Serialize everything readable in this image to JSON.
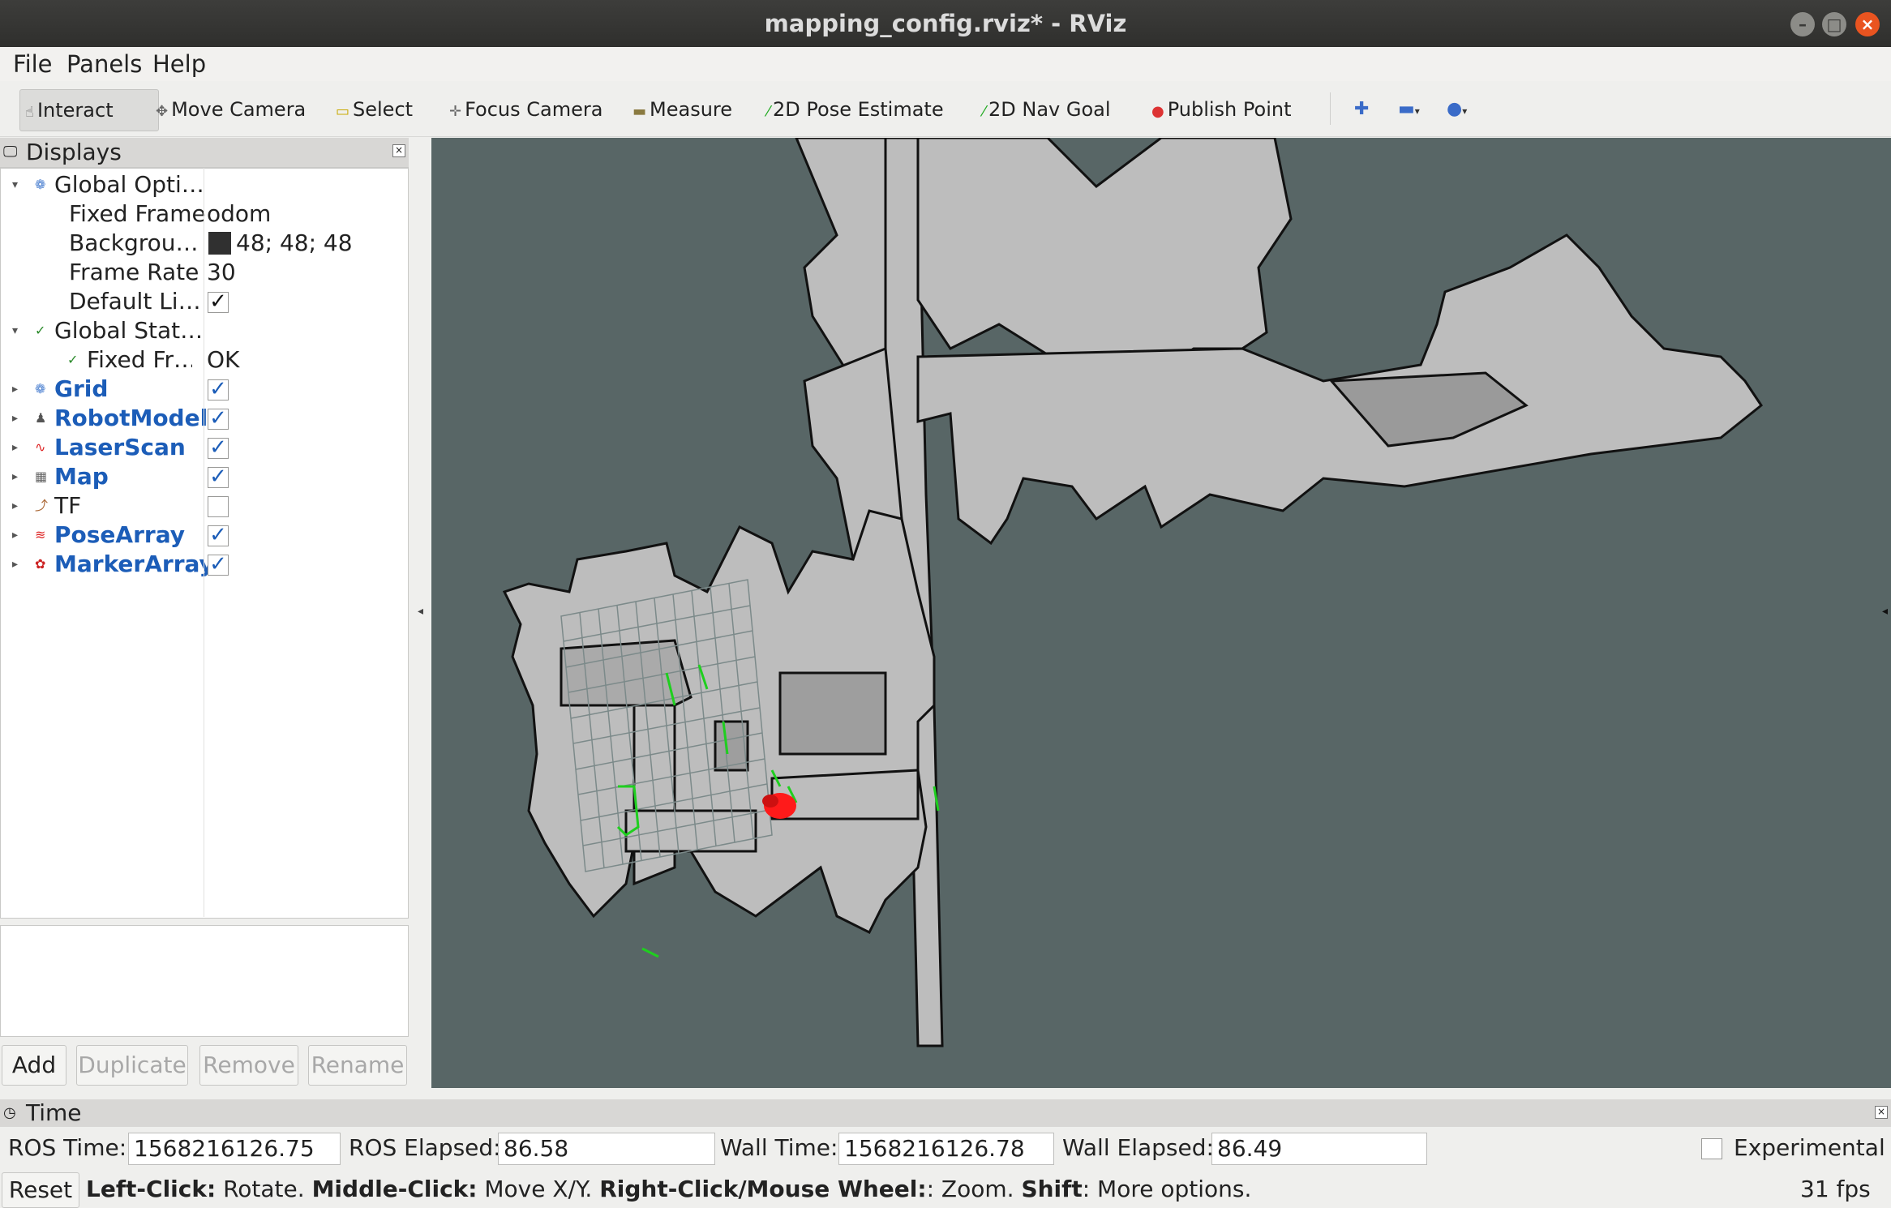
{
  "window": {
    "title": "mapping_config.rviz* - RViz"
  },
  "menu": {
    "file": "File",
    "panels": "Panels",
    "help": "Help"
  },
  "toolbar": {
    "interact": "Interact",
    "move_camera": "Move Camera",
    "select": "Select",
    "focus_camera": "Focus Camera",
    "measure": "Measure",
    "pose_estimate": "2D Pose Estimate",
    "nav_goal": "2D Nav Goal",
    "publish_point": "Publish Point"
  },
  "displays": {
    "title": "Displays",
    "global_options": {
      "label": "Global Opti…",
      "fixed_frame": {
        "label": "Fixed Frame",
        "value": "odom"
      },
      "background": {
        "label": "Backgrou…",
        "value": "48; 48; 48",
        "swatch": "#303030"
      },
      "frame_rate": {
        "label": "Frame Rate",
        "value": "30"
      },
      "default_light": {
        "label": "Default Li…",
        "checked": true
      }
    },
    "global_status": {
      "label": "Global Stat…",
      "fixed_frame": {
        "label": "Fixed Fr…",
        "value": "OK"
      }
    },
    "items": [
      {
        "label": "Grid",
        "checked": true,
        "icon": "grid-icon"
      },
      {
        "label": "RobotModel",
        "checked": true,
        "icon": "robot-icon"
      },
      {
        "label": "LaserScan",
        "checked": true,
        "icon": "laser-icon"
      },
      {
        "label": "Map",
        "checked": true,
        "icon": "map-icon"
      },
      {
        "label": "TF",
        "checked": false,
        "icon": "tf-icon"
      },
      {
        "label": "PoseArray",
        "checked": true,
        "icon": "pose-array-icon"
      },
      {
        "label": "MarkerArray",
        "checked": true,
        "icon": "marker-icon"
      }
    ],
    "buttons": {
      "add": "Add",
      "duplicate": "Duplicate",
      "remove": "Remove",
      "rename": "Rename"
    }
  },
  "viewport": {
    "background": "#586666",
    "map_free": "#c0c0c0",
    "scan_color": "#1fcf1f",
    "particles_color": "#ff1a1a"
  },
  "time": {
    "title": "Time",
    "ros_time_label": "ROS Time:",
    "ros_time": "1568216126.75",
    "ros_elapsed_label": "ROS Elapsed:",
    "ros_elapsed": "86.58",
    "wall_time_label": "Wall Time:",
    "wall_time": "1568216126.78",
    "wall_elapsed_label": "Wall Elapsed:",
    "wall_elapsed": "86.49",
    "experimental": "Experimental"
  },
  "status": {
    "reset": "Reset",
    "lc_b": "Left-Click:",
    "lc": " Rotate. ",
    "mc_b": "Middle-Click:",
    "mc": " Move X/Y. ",
    "rc_b": "Right-Click/Mouse Wheel:",
    "rc": ": Zoom. ",
    "sh_b": "Shift",
    "sh": ": More options.",
    "fps": "31 fps"
  }
}
